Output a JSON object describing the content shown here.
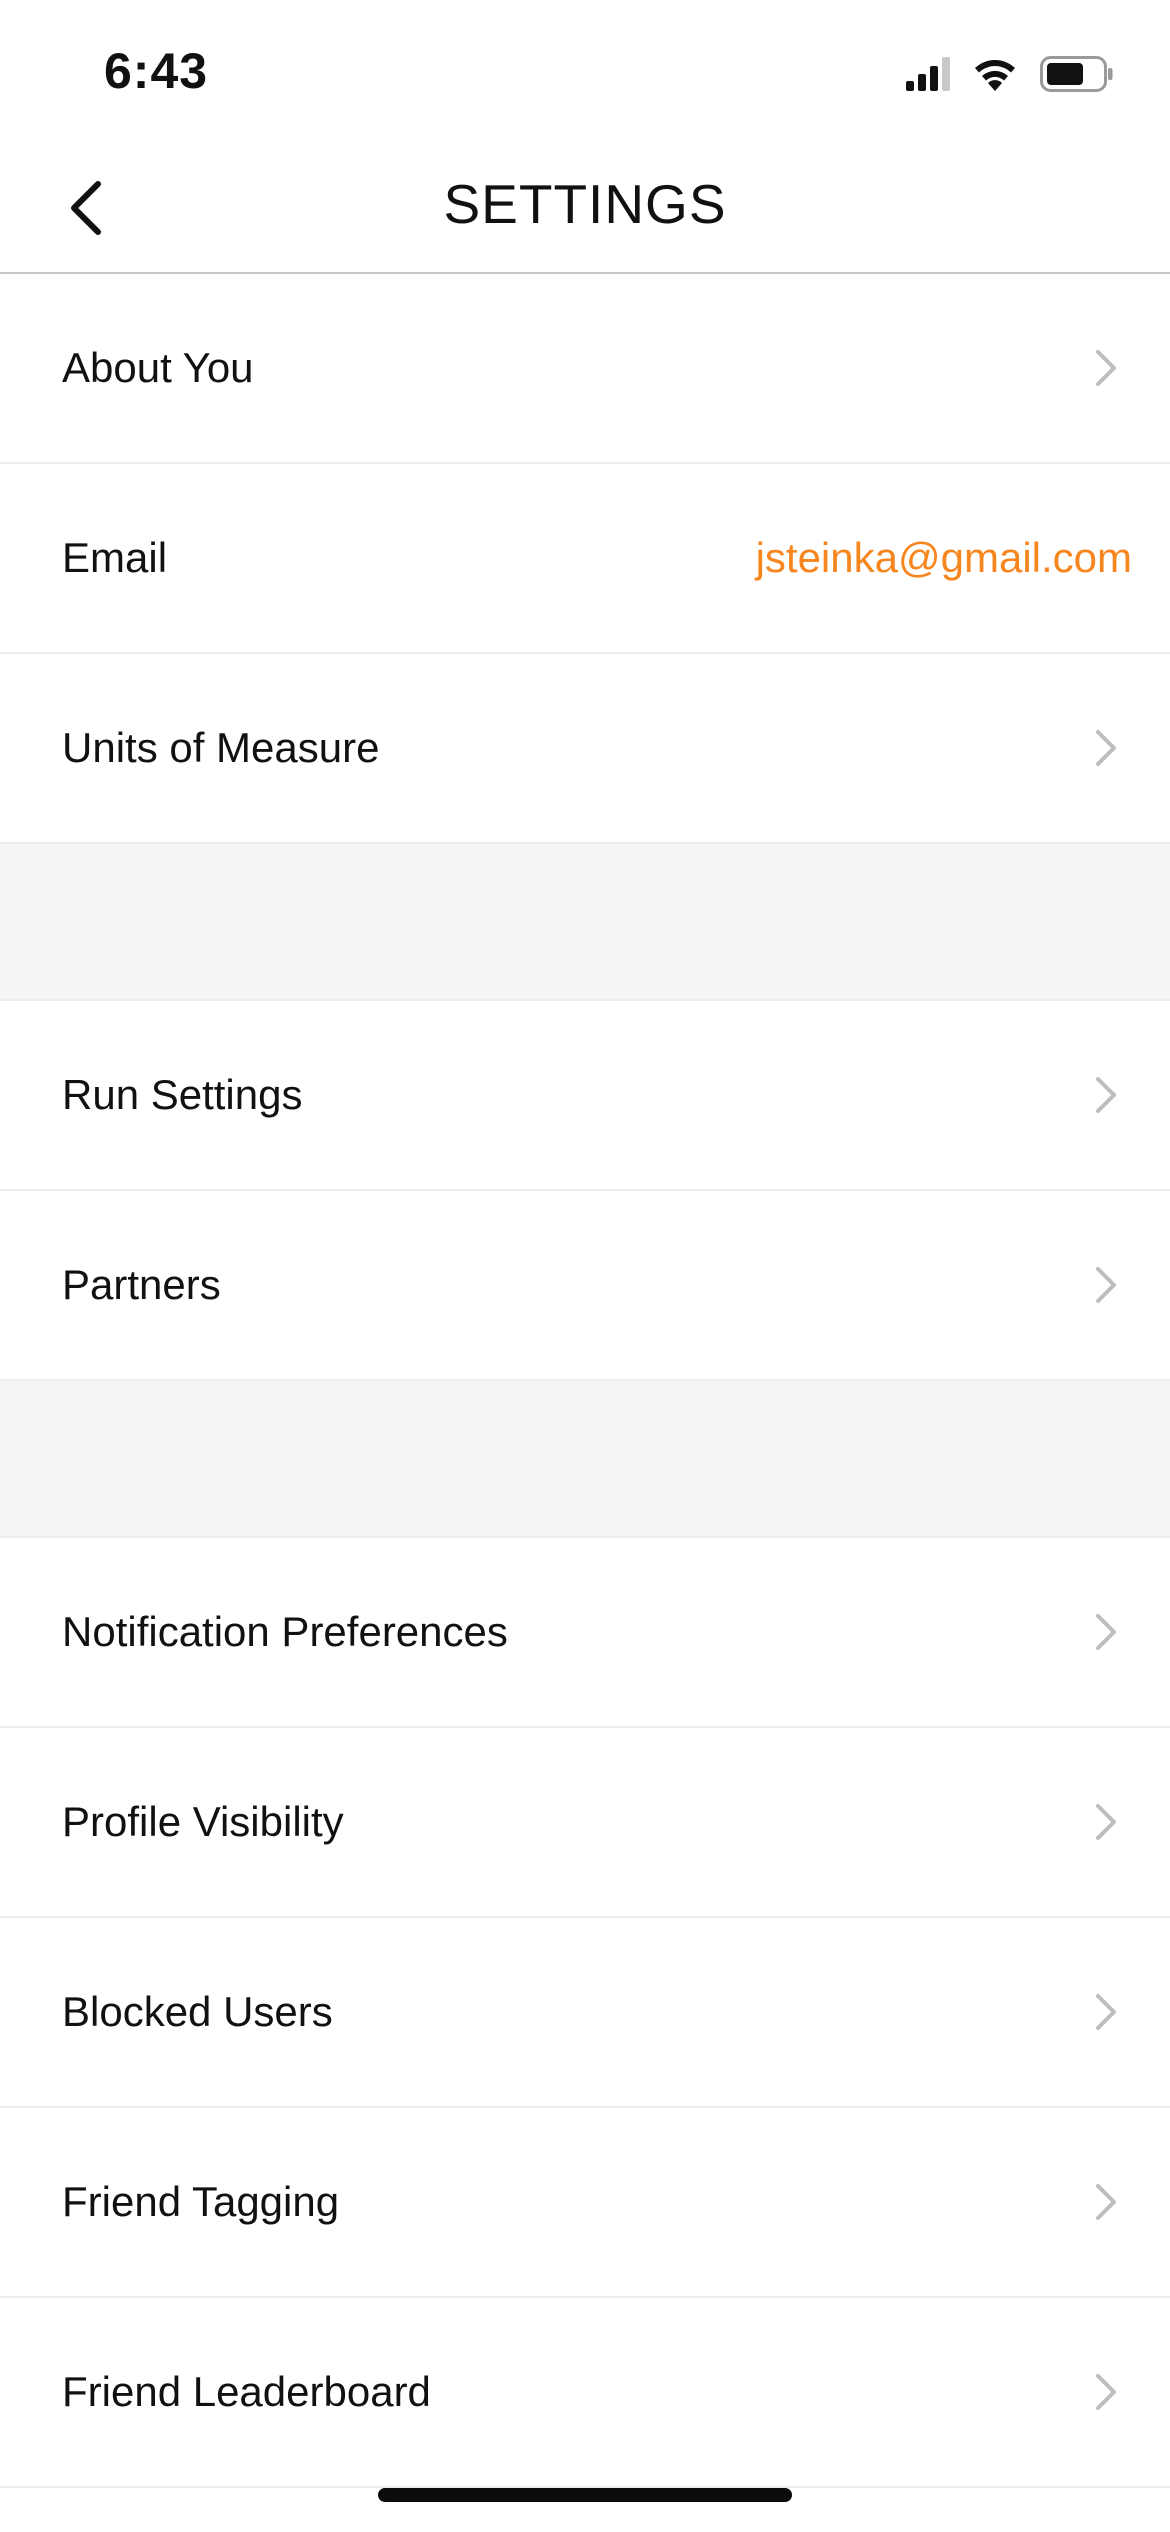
{
  "status_bar": {
    "time": "6:43",
    "icons": [
      "cellular-signal-icon",
      "wifi-icon",
      "battery-icon"
    ]
  },
  "header": {
    "title": "SETTINGS",
    "back_icon": "chevron-left-icon"
  },
  "colors": {
    "accent": "#f7861e",
    "divider": "#ececec",
    "section_gap": "#f5f5f5",
    "chevron": "#bdbdbd"
  },
  "sections": [
    {
      "rows": [
        {
          "label": "About You",
          "chevron": true
        },
        {
          "label": "Email",
          "value": "jsteinka@gmail.com"
        },
        {
          "label": "Units of Measure",
          "chevron": true
        }
      ]
    },
    {
      "rows": [
        {
          "label": "Run Settings",
          "chevron": true
        },
        {
          "label": "Partners",
          "chevron": true
        }
      ]
    },
    {
      "rows": [
        {
          "label": "Notification Preferences",
          "chevron": true
        },
        {
          "label": "Profile Visibility",
          "chevron": true
        },
        {
          "label": "Blocked Users",
          "chevron": true
        },
        {
          "label": "Friend Tagging",
          "chevron": true
        },
        {
          "label": "Friend Leaderboard",
          "chevron": true
        }
      ]
    }
  ]
}
